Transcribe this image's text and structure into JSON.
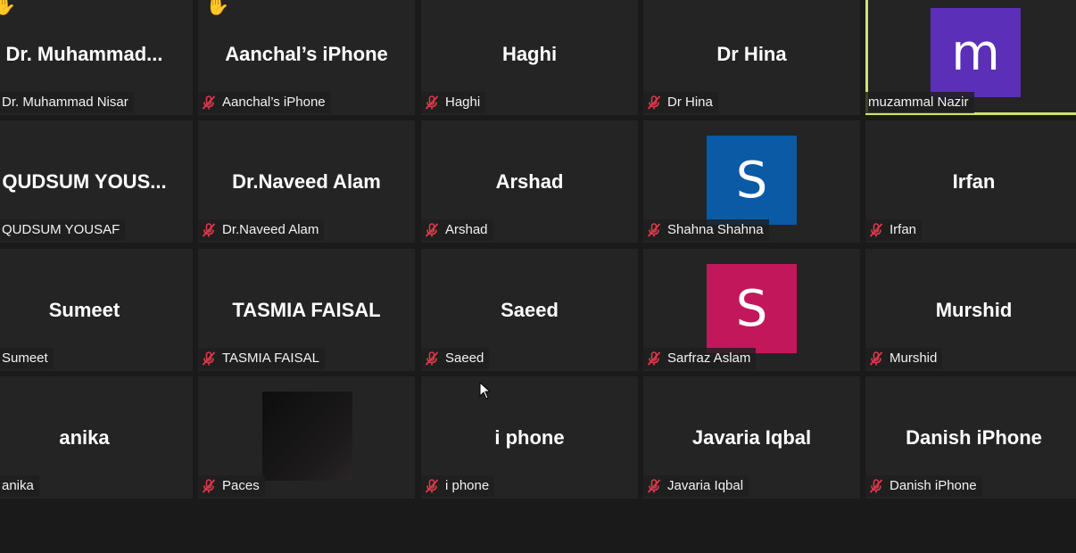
{
  "colors": {
    "tile_bg": "#242424",
    "gallery_bg": "#1a1a1a",
    "active_speaker_border": "#cfe36a",
    "mute_icon": "#e0394b"
  },
  "tiles": [
    {
      "big_name": "Dr.  Muhammad...",
      "label": "Dr. Muhammad Nisar",
      "muted": false,
      "hand_raised": true
    },
    {
      "big_name": "Aanchal’s iPhone",
      "label": "Aanchal’s iPhone",
      "muted": true,
      "hand_raised": true
    },
    {
      "big_name": "Haghi",
      "label": "Haghi",
      "muted": true
    },
    {
      "big_name": "Dr Hina",
      "label": "Dr Hina",
      "muted": true
    },
    {
      "avatar_letter": "m",
      "avatar_color": "#5b2fb8",
      "label": "muzammal Nazir",
      "muted": false,
      "active_speaker": true
    },
    {
      "big_name": "QUDSUM  YOUS...",
      "label": "QUDSUM YOUSAF",
      "muted": false
    },
    {
      "big_name": "Dr.Naveed Alam",
      "label": "Dr.Naveed Alam",
      "muted": true
    },
    {
      "big_name": "Arshad",
      "label": "Arshad",
      "muted": true
    },
    {
      "avatar_letter": "S",
      "avatar_color": "#0a5aa6",
      "label": "Shahna Shahna",
      "muted": true
    },
    {
      "big_name": "Irfan",
      "label": "Irfan",
      "muted": true
    },
    {
      "big_name": "Sumeet",
      "label": "Sumeet",
      "muted": false
    },
    {
      "big_name": "TASMIA FAISAL",
      "label": "TASMIA FAISAL",
      "muted": true
    },
    {
      "big_name": "Saeed",
      "label": "Saeed",
      "muted": true
    },
    {
      "avatar_letter": "S",
      "avatar_color": "#c2185b",
      "label": "Sarfraz Aslam",
      "muted": true
    },
    {
      "big_name": "Murshid",
      "label": "Murshid",
      "muted": true
    },
    {
      "big_name": "anika",
      "label": "anika",
      "muted": false
    },
    {
      "video_thumbnail": true,
      "label": "Paces",
      "muted": true
    },
    {
      "big_name": "i phone",
      "label": "i phone",
      "muted": true
    },
    {
      "big_name": "Javaria Iqbal",
      "label": "Javaria Iqbal",
      "muted": true
    },
    {
      "big_name": "Danish iPhone",
      "label": "Danish iPhone",
      "muted": true
    }
  ]
}
